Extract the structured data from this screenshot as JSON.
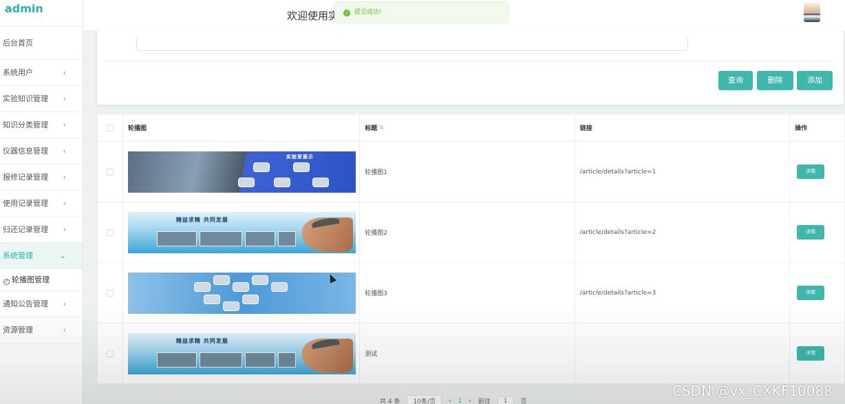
{
  "sidebar": {
    "brand": "admin",
    "items": [
      {
        "label": "后台首页"
      },
      {
        "label": "系统用户"
      },
      {
        "label": "实验知识管理"
      },
      {
        "label": "知识分类管理"
      },
      {
        "label": "仪器信息管理"
      },
      {
        "label": "报修记录管理"
      },
      {
        "label": "使用记录管理"
      },
      {
        "label": "归还记录管理"
      },
      {
        "label": "系统管理",
        "open": true
      },
      {
        "label": "轮播图管理",
        "sub": true
      },
      {
        "label": "通知公告管理"
      },
      {
        "label": "资源管理"
      }
    ]
  },
  "header": {
    "welcome": "欢迎使用实"
  },
  "toast": {
    "message": "提交成功!",
    "color": "#67c23a"
  },
  "search": {
    "buttons": {
      "query": "查询",
      "delete": "删除",
      "add": "添加"
    }
  },
  "table": {
    "headers": {
      "image": "轮播图",
      "title": "标题",
      "link": "链接",
      "actions": "操作"
    },
    "rows": [
      {
        "title": "轮播图1",
        "link": "/article/details?article=1",
        "banner_text": "实验室展示",
        "action": "详情"
      },
      {
        "title": "轮播图2",
        "link": "/article/details?article=2",
        "banner_text": "精益求精 共同发展",
        "action": "详情"
      },
      {
        "title": "轮播图3",
        "link": "/article/details?article=3",
        "banner_text": "",
        "action": "详情"
      },
      {
        "title": "测试",
        "link": "",
        "banner_text": "精益求精 共同发展",
        "action": "详情"
      }
    ]
  },
  "pagination": {
    "total": "共 4 条",
    "page_size": "10条/页",
    "prev": "‹",
    "current": "1",
    "next": "›",
    "goto": "前往",
    "goto_value": "1",
    "page_unit": "页"
  },
  "watermark": "CSDN @vx_CXKF10088",
  "colors": {
    "accent": "#3fb7ac",
    "brand": "#2bb3a8"
  }
}
